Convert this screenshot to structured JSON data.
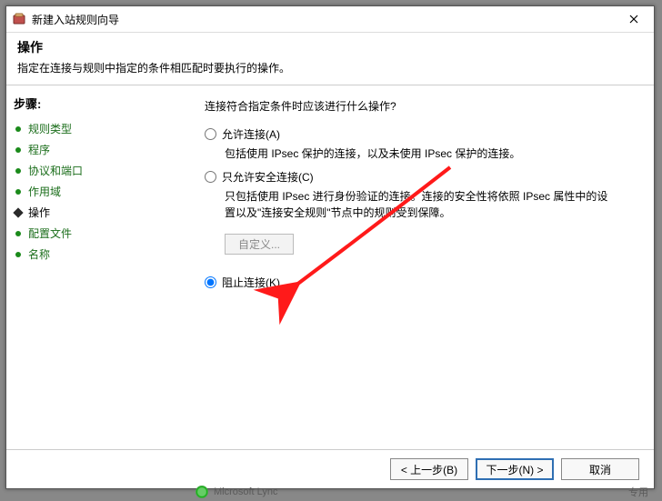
{
  "title": "新建入站规则向导",
  "header": {
    "title": "操作",
    "desc": "指定在连接与规则中指定的条件相匹配时要执行的操作。"
  },
  "sidebar": {
    "heading": "步骤:",
    "items": [
      {
        "label": "规则类型"
      },
      {
        "label": "程序"
      },
      {
        "label": "协议和端口"
      },
      {
        "label": "作用域"
      },
      {
        "label": "操作"
      },
      {
        "label": "配置文件"
      },
      {
        "label": "名称"
      }
    ],
    "current_index": 4
  },
  "main": {
    "question": "连接符合指定条件时应该进行什么操作?",
    "options": {
      "allow": {
        "label": "允许连接(A)",
        "desc": "包括使用 IPsec 保护的连接，以及未使用 IPsec 保护的连接。"
      },
      "secure": {
        "label": "只允许安全连接(C)",
        "desc": "只包括使用 IPsec 进行身份验证的连接。连接的安全性将依照 IPsec 属性中的设置以及\"连接安全规则\"节点中的规则受到保障。"
      },
      "block": {
        "label": "阻止连接(K)"
      }
    },
    "custom_button": "自定义...",
    "selected": "block"
  },
  "footer": {
    "back": "< 上一步(B)",
    "next": "下一步(N) >",
    "cancel": "取消"
  },
  "below": {
    "text": "Microsoft Lync",
    "right": "专用"
  }
}
